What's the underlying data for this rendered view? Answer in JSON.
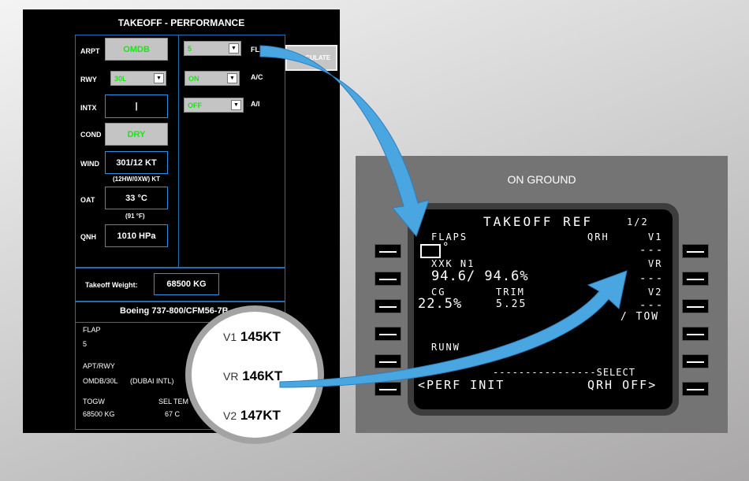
{
  "perf": {
    "title": "TAKEOFF - PERFORMANCE",
    "arpt_label": "ARPT",
    "arpt_value": "OMDB",
    "rwy_label": "RWY",
    "rwy_value": "30L",
    "intx_label": "INTX",
    "intx_value": "|",
    "cond_label": "COND",
    "cond_value": "DRY",
    "wind_label": "WIND",
    "wind_value": "301/12 KT",
    "wind_sub": "(12HW/0XW) KT",
    "oat_label": "OAT",
    "oat_value": "33 °C",
    "oat_sub": "(91 °F)",
    "qnh_label": "QNH",
    "qnh_value": "1010 HPa",
    "flap_select": "5",
    "flap_label": "FLAP",
    "ac_select": "ON",
    "ac_label": "A/C",
    "ai_select": "OFF",
    "ai_label": "A/I",
    "calculate": "CALCULATE",
    "tow_label": "Takeoff Weight:",
    "tow_value": "68500 KG",
    "aircraft": "Boeing 737-800/CFM56-7B",
    "res_flap_label": "FLAP",
    "res_flap_value": "5",
    "res_aptrwy_label": "APT/RWY",
    "res_aptrwy_value": "OMDB/30L",
    "res_apt_name": "(DUBAI INTL)",
    "res_togw_label": "TOGW",
    "res_togw_value": "68500 KG",
    "res_seltemp_label": "SEL TEM",
    "res_seltemp_value": "67 C"
  },
  "magnifier": {
    "v1_label": "V1",
    "v1_value": "145KT",
    "vr_label": "VR",
    "vr_value": "146KT",
    "v2_label": "V2",
    "v2_value": "147KT"
  },
  "fmc": {
    "header": "ON GROUND",
    "title": "TAKEOFF REF",
    "page": "1/2",
    "flaps_label": "FLAPS",
    "qrh_label": "QRH",
    "v1_label": "V1",
    "v1_value": "---",
    "deg_symbol": "°",
    "n1_label": "XXK N1",
    "vr_label": "VR",
    "vr_value": "---",
    "n1_value": "94.6/ 94.6%",
    "cg_label": "CG",
    "trim_label": "TRIM",
    "v2_label": "V2",
    "v2_value": "---",
    "cg_value": "22.5%",
    "trim_value": "5.25",
    "tow_label": "/ TOW",
    "runway_label": "RUNW",
    "select_line": "----------------SELECT",
    "perf_init": "<PERF INIT",
    "qrh_off": "QRH OFF>"
  },
  "colors": {
    "accent_blue": "#1f6fb2",
    "arrow_blue": "#4aa6e0",
    "entry_green": "#19e619",
    "field_gray": "#c4c4c4"
  }
}
